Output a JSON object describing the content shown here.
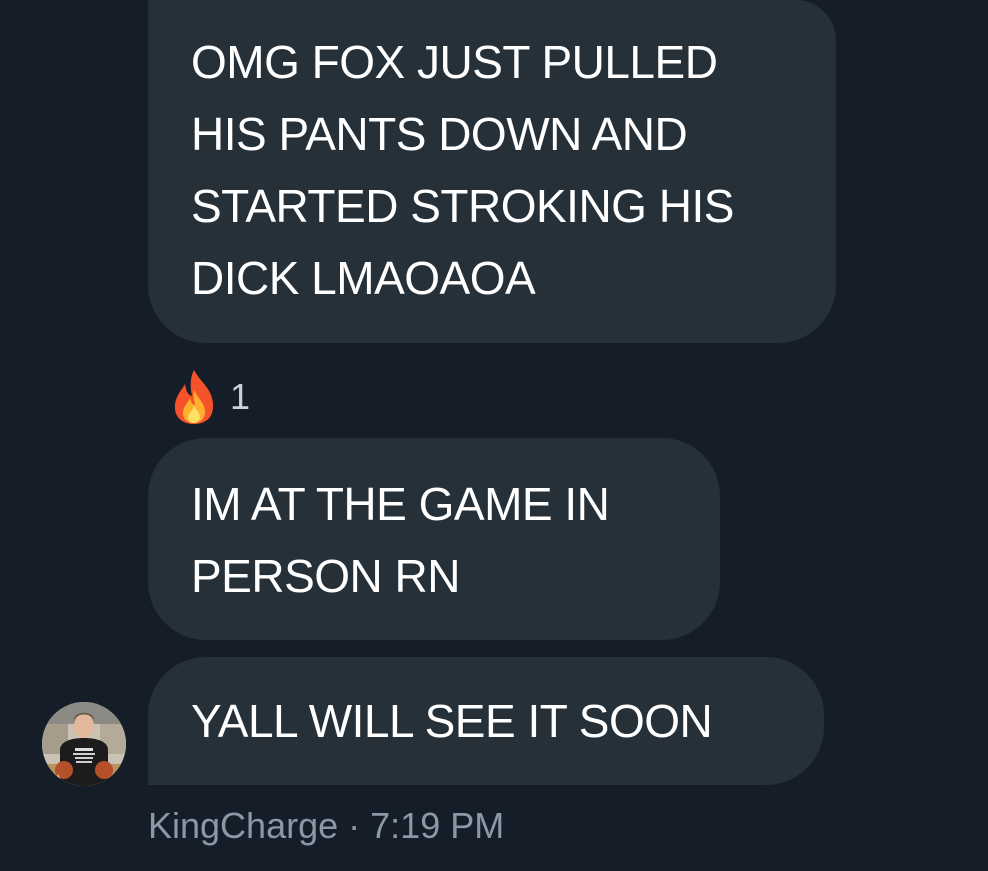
{
  "messages": [
    {
      "text_lines": [
        "OMG FOX JUST PULLED",
        "HIS PANTS DOWN AND",
        "STARTED STROKING HIS",
        "DICK LMAOAOA"
      ]
    },
    {
      "text_lines": [
        "IM AT THE GAME IN",
        "PERSON RN"
      ]
    },
    {
      "text_lines": [
        "YALL WILL SEE IT SOON"
      ]
    }
  ],
  "reaction": {
    "icon": "fire-emoji-icon",
    "count": "1"
  },
  "sender": {
    "name": "KingCharge",
    "separator": "·",
    "time": "7:19 PM",
    "avatar_icon": "user-avatar"
  },
  "colors": {
    "background": "#151d28",
    "bubble": "#253039",
    "text": "#ffffff",
    "meta": "#8b98a5"
  }
}
